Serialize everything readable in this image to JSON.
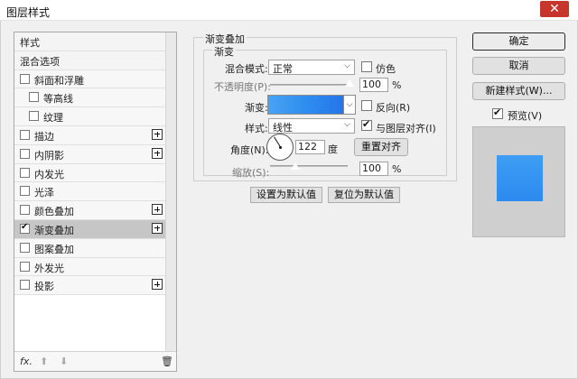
{
  "window": {
    "title": "图层样式",
    "close_glyph": "✕"
  },
  "left": {
    "items": [
      {
        "label": "样式",
        "checkbox": false,
        "checked": false,
        "indent": 0,
        "plus": false,
        "selected": false
      },
      {
        "label": "混合选项",
        "checkbox": false,
        "checked": false,
        "indent": 0,
        "plus": false,
        "selected": false
      },
      {
        "label": "斜面和浮雕",
        "checkbox": true,
        "checked": false,
        "indent": 0,
        "plus": false,
        "selected": false
      },
      {
        "label": "等高线",
        "checkbox": true,
        "checked": false,
        "indent": 1,
        "plus": false,
        "selected": false
      },
      {
        "label": "纹理",
        "checkbox": true,
        "checked": false,
        "indent": 1,
        "plus": false,
        "selected": false
      },
      {
        "label": "描边",
        "checkbox": true,
        "checked": false,
        "indent": 0,
        "plus": true,
        "selected": false
      },
      {
        "label": "内阴影",
        "checkbox": true,
        "checked": false,
        "indent": 0,
        "plus": true,
        "selected": false
      },
      {
        "label": "内发光",
        "checkbox": true,
        "checked": false,
        "indent": 0,
        "plus": false,
        "selected": false
      },
      {
        "label": "光泽",
        "checkbox": true,
        "checked": false,
        "indent": 0,
        "plus": false,
        "selected": false
      },
      {
        "label": "颜色叠加",
        "checkbox": true,
        "checked": false,
        "indent": 0,
        "plus": true,
        "selected": false
      },
      {
        "label": "渐变叠加",
        "checkbox": true,
        "checked": true,
        "indent": 0,
        "plus": true,
        "selected": true
      },
      {
        "label": "图案叠加",
        "checkbox": true,
        "checked": false,
        "indent": 0,
        "plus": false,
        "selected": false
      },
      {
        "label": "外发光",
        "checkbox": true,
        "checked": false,
        "indent": 0,
        "plus": false,
        "selected": false
      },
      {
        "label": "投影",
        "checkbox": true,
        "checked": false,
        "indent": 0,
        "plus": true,
        "selected": false
      }
    ],
    "tools": {
      "fx": "fx.",
      "up": "⬆",
      "down": "⬇",
      "trash": "🗑"
    }
  },
  "section": {
    "title": "渐变叠加",
    "subtitle": "渐变",
    "blend_mode_label": "混合模式:",
    "blend_mode_value": "正常",
    "dither_label": "仿色",
    "opacity_label": "不透明度(P):",
    "opacity_value": "100",
    "opacity_fraction": 1.0,
    "percent": "%",
    "gradient_label": "渐变:",
    "reverse_label": "反向(R)",
    "style_label": "样式:",
    "style_value": "线性",
    "align_label": "与图层对齐(I)",
    "angle_label": "角度(N):",
    "angle_value": "122",
    "degree_unit": "度",
    "reset_align_label": "重置对齐",
    "scale_label": "缩放(S):",
    "scale_value": "100",
    "scale_fraction": 0.33,
    "set_default_label": "设置为默认值",
    "reset_default_label": "复位为默认值"
  },
  "right": {
    "ok_label": "确定",
    "cancel_label": "取消",
    "new_style_label": "新建样式(W)...",
    "preview_label": "预览(V)",
    "preview_checked": true
  },
  "colors": {
    "gradient_start": "#4aa3f2",
    "gradient_end": "#2575e8",
    "close_button": "#c7362c",
    "selected_row": "#c6c6c6"
  }
}
